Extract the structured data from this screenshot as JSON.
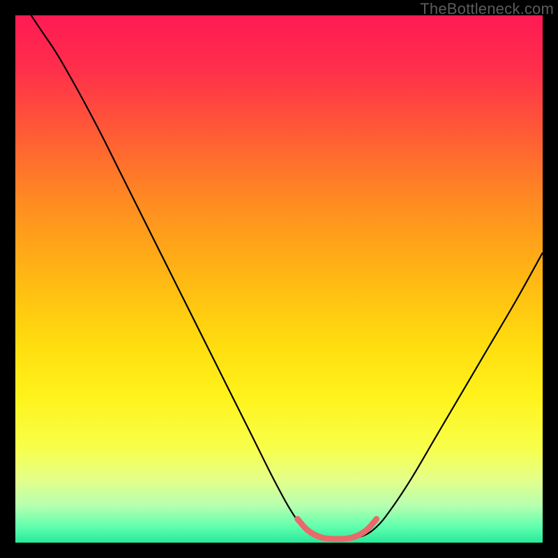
{
  "watermark": "TheBottleneck.com",
  "chart_data": {
    "type": "line",
    "title": "",
    "xlabel": "",
    "ylabel": "",
    "xlim": [
      0,
      100
    ],
    "ylim": [
      0,
      100
    ],
    "background": {
      "type": "vertical-gradient",
      "stops": [
        {
          "offset": 0.0,
          "color": "#ff1a54"
        },
        {
          "offset": 0.1,
          "color": "#ff2e4b"
        },
        {
          "offset": 0.22,
          "color": "#ff5a36"
        },
        {
          "offset": 0.35,
          "color": "#ff8a22"
        },
        {
          "offset": 0.5,
          "color": "#ffb813"
        },
        {
          "offset": 0.62,
          "color": "#ffdc0f"
        },
        {
          "offset": 0.72,
          "color": "#fff21a"
        },
        {
          "offset": 0.82,
          "color": "#f8ff4a"
        },
        {
          "offset": 0.88,
          "color": "#e4ff8a"
        },
        {
          "offset": 0.93,
          "color": "#b6ffb0"
        },
        {
          "offset": 0.97,
          "color": "#5fffad"
        },
        {
          "offset": 1.0,
          "color": "#28e89a"
        }
      ]
    },
    "series": [
      {
        "name": "bottleneck-curve",
        "stroke": "#000000",
        "stroke_width": 2.2,
        "points": [
          {
            "x": 3.0,
            "y": 100.0
          },
          {
            "x": 5.0,
            "y": 97.0
          },
          {
            "x": 8.0,
            "y": 92.5
          },
          {
            "x": 12.0,
            "y": 85.5
          },
          {
            "x": 16.0,
            "y": 78.0
          },
          {
            "x": 20.0,
            "y": 70.0
          },
          {
            "x": 25.0,
            "y": 60.0
          },
          {
            "x": 30.0,
            "y": 50.0
          },
          {
            "x": 35.0,
            "y": 40.0
          },
          {
            "x": 40.0,
            "y": 30.0
          },
          {
            "x": 45.0,
            "y": 20.0
          },
          {
            "x": 49.0,
            "y": 12.0
          },
          {
            "x": 52.0,
            "y": 6.5
          },
          {
            "x": 54.5,
            "y": 3.0
          },
          {
            "x": 57.0,
            "y": 1.3
          },
          {
            "x": 60.0,
            "y": 0.7
          },
          {
            "x": 63.0,
            "y": 0.7
          },
          {
            "x": 66.0,
            "y": 1.3
          },
          {
            "x": 68.5,
            "y": 3.0
          },
          {
            "x": 71.0,
            "y": 6.0
          },
          {
            "x": 75.0,
            "y": 12.0
          },
          {
            "x": 80.0,
            "y": 20.5
          },
          {
            "x": 85.0,
            "y": 29.0
          },
          {
            "x": 90.0,
            "y": 37.5
          },
          {
            "x": 95.0,
            "y": 46.0
          },
          {
            "x": 100.0,
            "y": 55.0
          }
        ]
      },
      {
        "name": "bottom-highlight",
        "stroke": "#e86a6a",
        "stroke_width": 8.5,
        "linecap": "round",
        "points": [
          {
            "x": 53.5,
            "y": 4.5
          },
          {
            "x": 55.5,
            "y": 2.3
          },
          {
            "x": 58.0,
            "y": 1.0
          },
          {
            "x": 61.0,
            "y": 0.7
          },
          {
            "x": 64.0,
            "y": 1.0
          },
          {
            "x": 66.5,
            "y": 2.3
          },
          {
            "x": 68.5,
            "y": 4.5
          }
        ]
      }
    ]
  }
}
